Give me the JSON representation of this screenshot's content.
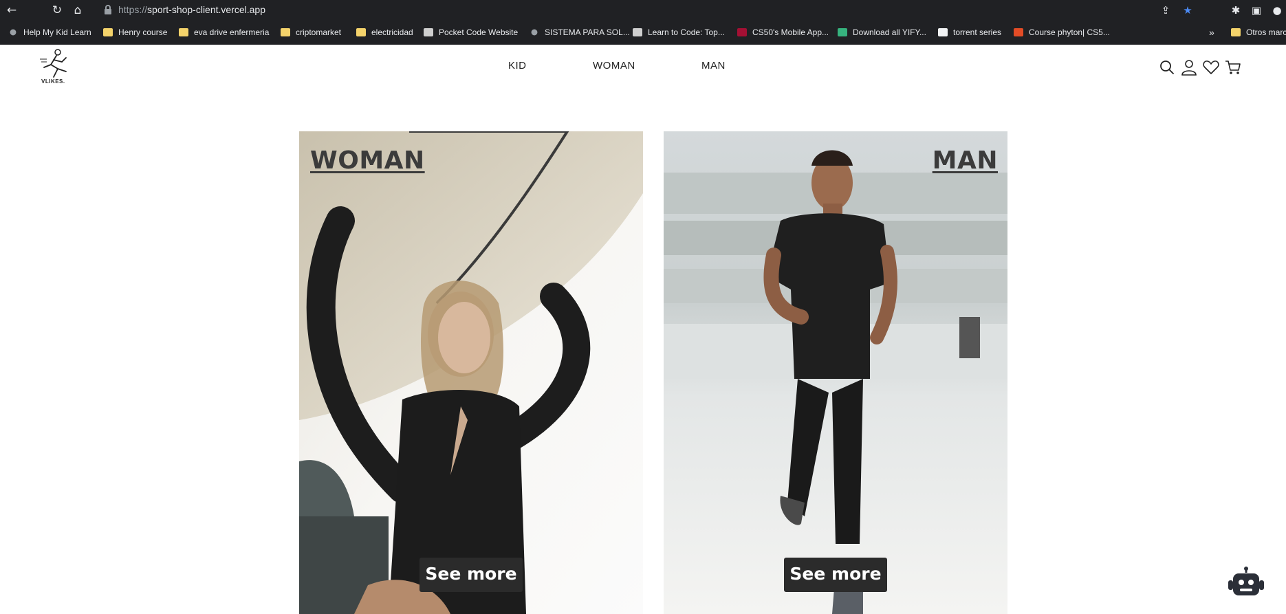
{
  "browser": {
    "url_scheme": "https://",
    "url_host": "sport-shop-client.vercel.app",
    "bookmarks": [
      {
        "label": "Help My Kid Learn",
        "icon": "globe-icon"
      },
      {
        "label": "Henry course",
        "icon": "folder-icon"
      },
      {
        "label": "eva drive enfermeria",
        "icon": "folder-icon"
      },
      {
        "label": "criptomarket",
        "icon": "folder-icon"
      },
      {
        "label": "electricidad",
        "icon": "folder-icon"
      },
      {
        "label": "Pocket Code Website",
        "icon": "pocket-code-icon"
      },
      {
        "label": "SISTEMA PARA SOL...",
        "icon": "globe-icon"
      },
      {
        "label": "Learn to Code: Top...",
        "icon": "site-icon"
      },
      {
        "label": "CS50's Mobile App...",
        "icon": "harvard-icon"
      },
      {
        "label": "Download all YIFY...",
        "icon": "download-icon"
      },
      {
        "label": "torrent series",
        "icon": "torrent-icon"
      },
      {
        "label": "Course phyton| CS5...",
        "icon": "code-icon"
      }
    ],
    "overflow_label": "»",
    "other_bookmarks": "Otros marc"
  },
  "header": {
    "logo_text": "VLIKES.",
    "nav": [
      "KID",
      "WOMAN",
      "MAN"
    ]
  },
  "cards": [
    {
      "title": "WOMAN",
      "button": "See more"
    },
    {
      "title": "MAN",
      "button": "See more"
    }
  ],
  "colors": {
    "chrome_bg": "#202124",
    "button_bg": "#2b2b2b",
    "title_text": "#3b3b3b"
  }
}
